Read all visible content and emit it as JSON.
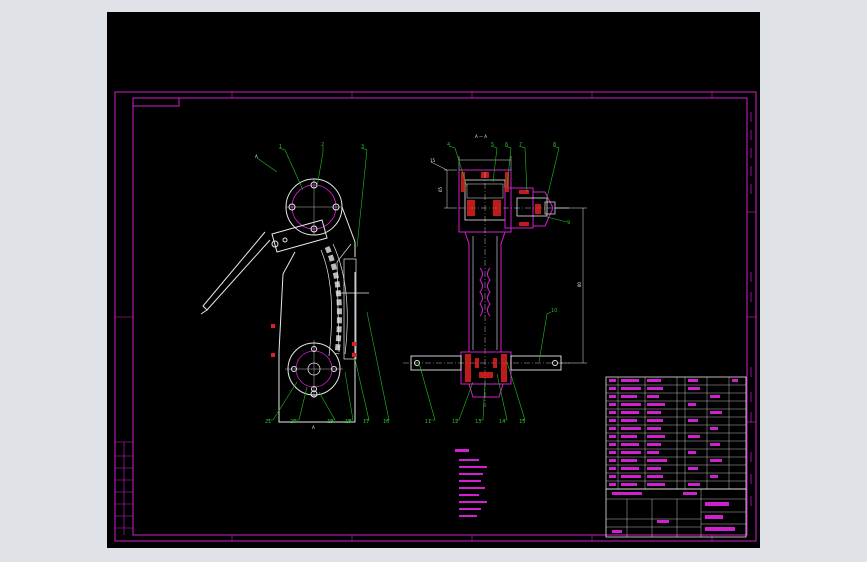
{
  "drawing": {
    "view_section_label": "A — A",
    "view_marker_label": "A",
    "dimension_height": "65",
    "dimension_length": "80",
    "dimension_offset": "15"
  },
  "left_view_balloons": [
    "1",
    "2",
    "3",
    "21",
    "20",
    "19",
    "18",
    "17",
    "16"
  ],
  "right_view_balloons": [
    "4",
    "5",
    "6",
    "7",
    "8",
    "9",
    "10",
    "11",
    "12",
    "13",
    "14",
    "15"
  ],
  "colors": {
    "background": "#000000",
    "outline": "#d020d0",
    "geometry": "#e8e8e8",
    "leader": "#20c020",
    "hatch": "#e02020"
  }
}
